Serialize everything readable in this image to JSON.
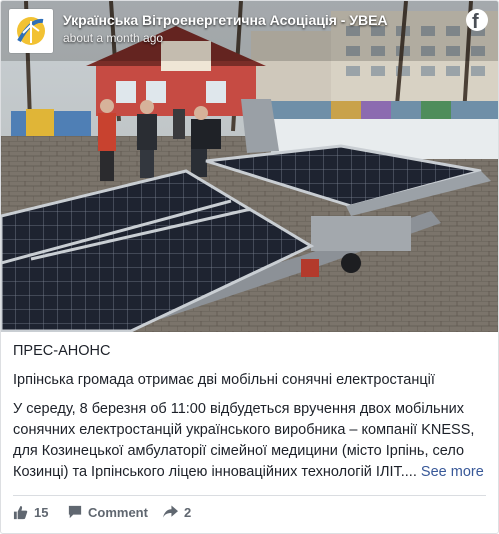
{
  "post": {
    "page_name": "Українська Вітроенергетична Асоціація - УВЕА",
    "time": "about a month ago",
    "heading": "ПРЕС-АНОНС",
    "subheading": "Ірпінська громада отримає дві мобільні сонячні електростанції",
    "body": "У середу, 8 березня об 11:00 відбудеться вручення двох мобільних сонячних електростанцій українського виробника – компанії KNESS, для Козинецької амбулаторії сімейної медицини (місто Ірпінь, село Козинці) та Ірпінського ліцею інноваційних технологій ІЛІТ....",
    "see_more": "See more"
  },
  "actions": {
    "likes": "15",
    "comment": "Comment",
    "shares": "2"
  },
  "icons": [
    "logo-icon",
    "facebook-icon",
    "like-icon",
    "comment-icon",
    "share-icon"
  ],
  "colors": {
    "link": "#385898",
    "text": "#1d2129",
    "muted": "#606770"
  }
}
